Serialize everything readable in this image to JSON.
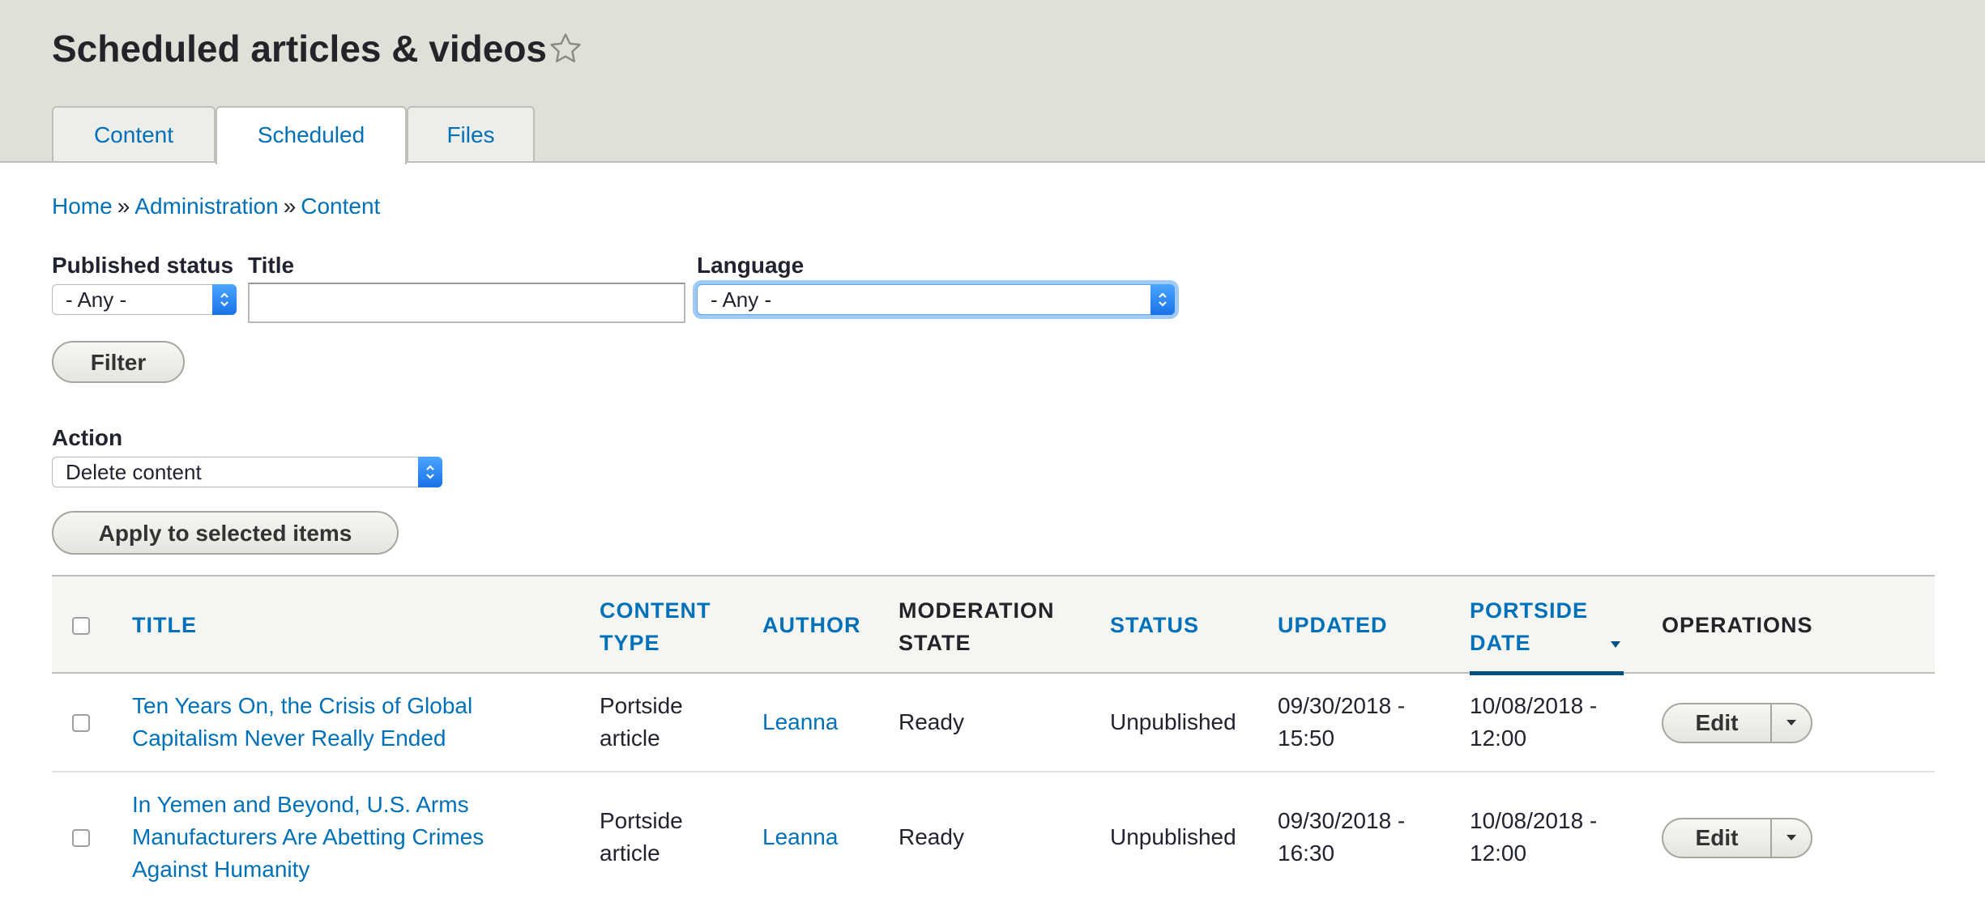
{
  "page": {
    "title": "Scheduled articles & videos"
  },
  "tabs": [
    {
      "label": "Content"
    },
    {
      "label": "Scheduled"
    },
    {
      "label": "Files"
    }
  ],
  "breadcrumb": {
    "items": [
      "Home",
      "Administration",
      "Content"
    ],
    "separator": "»"
  },
  "filters": {
    "published_status": {
      "label": "Published status",
      "value": "- Any -"
    },
    "title": {
      "label": "Title",
      "value": ""
    },
    "language": {
      "label": "Language",
      "value": "- Any -"
    },
    "filter_button": "Filter"
  },
  "actions": {
    "label": "Action",
    "value": "Delete content",
    "apply_button": "Apply to selected items"
  },
  "table": {
    "headers": {
      "title": "TITLE",
      "content_type": [
        "CONTENT",
        "TYPE"
      ],
      "author": "AUTHOR",
      "moderation_state": [
        "MODERATION",
        "STATE"
      ],
      "status": "STATUS",
      "updated": "UPDATED",
      "portside_date": [
        "PORTSIDE",
        "DATE"
      ],
      "operations": "OPERATIONS"
    },
    "rows": [
      {
        "title": [
          "Ten Years On, the Crisis of Global",
          "Capitalism Never Really Ended"
        ],
        "content_type": [
          "Portside",
          "article"
        ],
        "author": "Leanna",
        "moderation_state": "Ready",
        "status": "Unpublished",
        "updated": [
          "09/30/2018 -",
          "15:50"
        ],
        "portside_date": [
          "10/08/2018 -",
          "12:00"
        ],
        "operation": "Edit"
      },
      {
        "title": [
          "In Yemen and Beyond, U.S. Arms",
          "Manufacturers Are Abetting Crimes",
          "Against Humanity"
        ],
        "content_type": [
          "Portside",
          "article"
        ],
        "author": "Leanna",
        "moderation_state": "Ready",
        "status": "Unpublished",
        "updated": [
          "09/30/2018 -",
          "16:30"
        ],
        "portside_date": [
          "10/08/2018 -",
          "12:00"
        ],
        "operation": "Edit"
      }
    ]
  },
  "colors": {
    "link": "#0071b8",
    "header_bg": "#e0e0d8",
    "focus": "#9ecaf5"
  },
  "icons": {
    "favorite": "star-outline-icon",
    "select": "select-arrows-icon",
    "sort": "sort-desc-icon",
    "dropdown": "caret-down-icon"
  }
}
